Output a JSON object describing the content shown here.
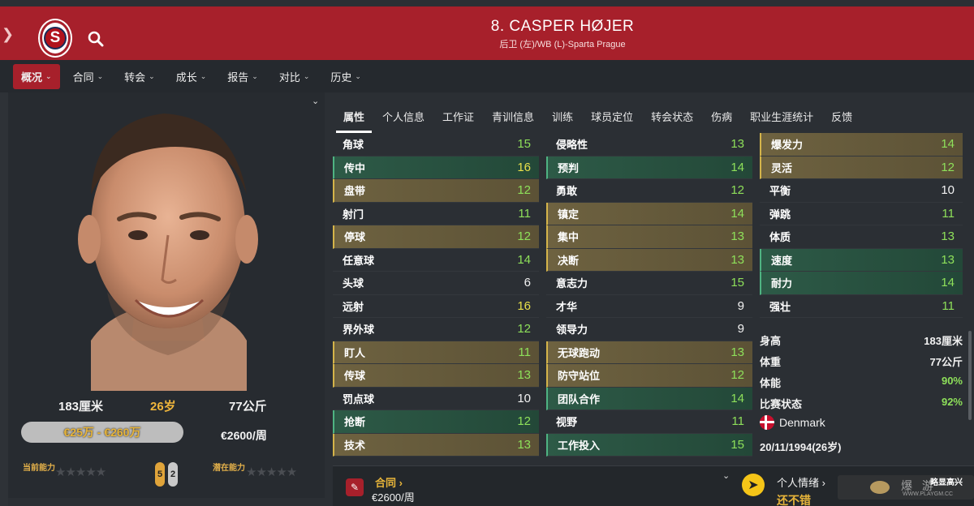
{
  "header": {
    "title": "8. CASPER HØJER",
    "subtitle": "后卫 (左)/WB (L)-Sparta Prague",
    "logo_letter": "S"
  },
  "nav": [
    "概况",
    "合同",
    "转会",
    "成长",
    "报告",
    "对比",
    "历史"
  ],
  "profile": {
    "height": "183厘米",
    "age": "26岁",
    "weight": "77公斤",
    "value_range": "€25万 - €260万",
    "wage": "€2600/周",
    "current_ability_label": "当前能力",
    "potential_ability_label": "潜在能力",
    "left_foot": "5",
    "right_foot": "2"
  },
  "tabs": [
    "属性",
    "个人信息",
    "工作证",
    "青训信息",
    "训练",
    "球员定位",
    "转会状态",
    "伤病",
    "职业生涯统计",
    "反馈"
  ],
  "attributes": {
    "technical": [
      {
        "name": "角球",
        "value": "15",
        "color": "green",
        "hl": ""
      },
      {
        "name": "传中",
        "value": "16",
        "color": "yellow",
        "hl": "green"
      },
      {
        "name": "盘带",
        "value": "12",
        "color": "green",
        "hl": "gold"
      },
      {
        "name": "射门",
        "value": "11",
        "color": "green",
        "hl": ""
      },
      {
        "name": "停球",
        "value": "12",
        "color": "green",
        "hl": "gold"
      },
      {
        "name": "任意球",
        "value": "14",
        "color": "green",
        "hl": ""
      },
      {
        "name": "头球",
        "value": "6",
        "color": "white",
        "hl": ""
      },
      {
        "name": "远射",
        "value": "16",
        "color": "yellow",
        "hl": ""
      },
      {
        "name": "界外球",
        "value": "12",
        "color": "green",
        "hl": ""
      },
      {
        "name": "盯人",
        "value": "11",
        "color": "green",
        "hl": "gold"
      },
      {
        "name": "传球",
        "value": "13",
        "color": "green",
        "hl": "gold"
      },
      {
        "name": "罚点球",
        "value": "10",
        "color": "white",
        "hl": ""
      },
      {
        "name": "抢断",
        "value": "12",
        "color": "green",
        "hl": "green"
      },
      {
        "name": "技术",
        "value": "13",
        "color": "green",
        "hl": "gold"
      }
    ],
    "mental": [
      {
        "name": "侵略性",
        "value": "13",
        "color": "green",
        "hl": ""
      },
      {
        "name": "预判",
        "value": "14",
        "color": "green",
        "hl": "green"
      },
      {
        "name": "勇敢",
        "value": "12",
        "color": "green",
        "hl": ""
      },
      {
        "name": "镇定",
        "value": "14",
        "color": "green",
        "hl": "gold"
      },
      {
        "name": "集中",
        "value": "13",
        "color": "green",
        "hl": "gold"
      },
      {
        "name": "决断",
        "value": "13",
        "color": "green",
        "hl": "gold"
      },
      {
        "name": "意志力",
        "value": "15",
        "color": "green",
        "hl": ""
      },
      {
        "name": "才华",
        "value": "9",
        "color": "white",
        "hl": ""
      },
      {
        "name": "领导力",
        "value": "9",
        "color": "white",
        "hl": ""
      },
      {
        "name": "无球跑动",
        "value": "13",
        "color": "green",
        "hl": "gold"
      },
      {
        "name": "防守站位",
        "value": "12",
        "color": "green",
        "hl": "gold"
      },
      {
        "name": "团队合作",
        "value": "14",
        "color": "green",
        "hl": "green"
      },
      {
        "name": "视野",
        "value": "11",
        "color": "green",
        "hl": ""
      },
      {
        "name": "工作投入",
        "value": "15",
        "color": "green",
        "hl": "green"
      }
    ],
    "physical": [
      {
        "name": "爆发力",
        "value": "14",
        "color": "green",
        "hl": "gold"
      },
      {
        "name": "灵活",
        "value": "12",
        "color": "green",
        "hl": "gold"
      },
      {
        "name": "平衡",
        "value": "10",
        "color": "white",
        "hl": ""
      },
      {
        "name": "弹跳",
        "value": "11",
        "color": "green",
        "hl": ""
      },
      {
        "name": "体质",
        "value": "13",
        "color": "green",
        "hl": ""
      },
      {
        "name": "速度",
        "value": "13",
        "color": "green",
        "hl": "green"
      },
      {
        "name": "耐力",
        "value": "14",
        "color": "green",
        "hl": "green"
      },
      {
        "name": "强壮",
        "value": "11",
        "color": "green",
        "hl": ""
      }
    ]
  },
  "info": {
    "height_label": "身高",
    "height_value": "183厘米",
    "weight_label": "体重",
    "weight_value": "77公斤",
    "fitness_label": "体能",
    "fitness_value": "90%",
    "match_label": "比赛状态",
    "match_value": "92%",
    "nation": "Denmark",
    "dob": "20/11/1994(26岁)"
  },
  "bottom": {
    "contract_label": "合同 ›",
    "contract_value": "€2600/周",
    "mood_label": "个人情绪 ›",
    "mood_value": "还不错",
    "watermark_text": "爆  游",
    "watermark_sub": "WWW.PLAYGM.CC",
    "corner_text": "略显高兴"
  },
  "colors": {
    "header_red": "#a7202b",
    "green_value": "#8ee05a",
    "yellow_value": "#e8e04a",
    "gold_accent": "#e8b53a"
  }
}
